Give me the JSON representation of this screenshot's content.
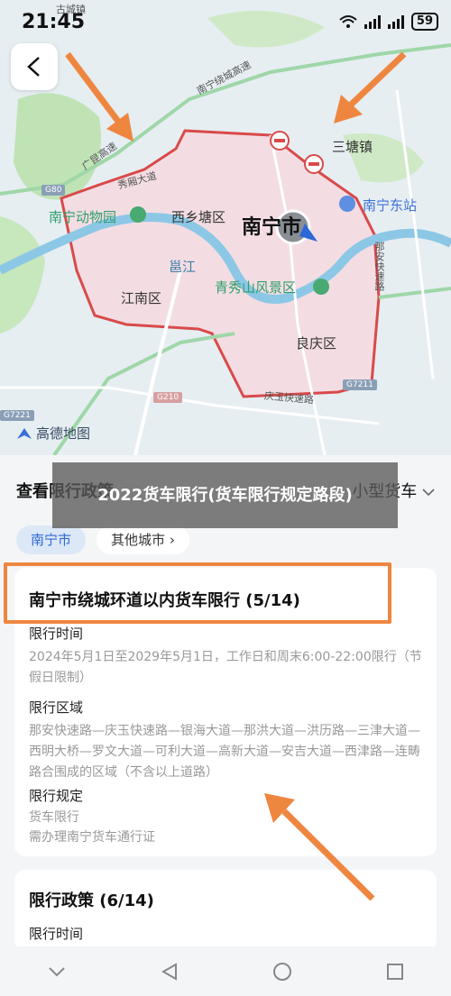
{
  "status": {
    "time": "21:45",
    "battery": "59"
  },
  "map": {
    "labels": {
      "nanning": "南宁市",
      "xixiangtang": "西乡塘区",
      "jiangnan": "江南区",
      "liangqing": "良庆区",
      "yongjiang": "邕江",
      "zoo": "南宁动物园",
      "qingxiushan": "青秀山风景区",
      "dongzhan": "南宁东站",
      "santang": "三塘镇",
      "xiuxiang": "秀厢大道",
      "guangrao": "广昆高速",
      "raocheng": "南宁绕城高速",
      "qingyu": "庆玉快速路",
      "naan": "那安快速路",
      "guyuan": "古城镇"
    },
    "road_tags": {
      "g80": "G80",
      "g210": "G210",
      "g7211": "G7211",
      "g7221": "G7221"
    },
    "logo": "高德地图",
    "colors": {
      "restricted_zone": "#f3dde3",
      "restricted_border": "#d94a4a",
      "river": "#8cc8e6"
    }
  },
  "banner": {
    "text": "2022货车限行(货车限行规定路段)"
  },
  "sheet": {
    "title": "查看限行政策",
    "vehicle_type": "小型货车",
    "chips": [
      "南宁市",
      "其他城市"
    ],
    "cards": [
      {
        "title": "南宁市绕城环道以内货车限行 (5/14)",
        "time_title": "限行时间",
        "time_body": "2024年5月1日至2029年5月1日，工作日和周末6:00-22:00限行（节假日限制）",
        "area_title": "限行区域",
        "area_body": "那安快速路—庆玉快速路—银海大道—那洪大道—洪历路—三津大道—西明大桥—罗文大道—可利大道—高新大道—安吉大道—西津路—连畴路合围成的区域（不含以上道路）",
        "rule_title": "限行规定",
        "rule_body_1": "货车限行",
        "rule_body_2": "需办理南宁货车通行证"
      },
      {
        "title": "限行政策 (6/14)",
        "time_title": "限行时间"
      }
    ]
  },
  "colors": {
    "accent": "#2c68d6",
    "annotation": "#ef8640"
  }
}
